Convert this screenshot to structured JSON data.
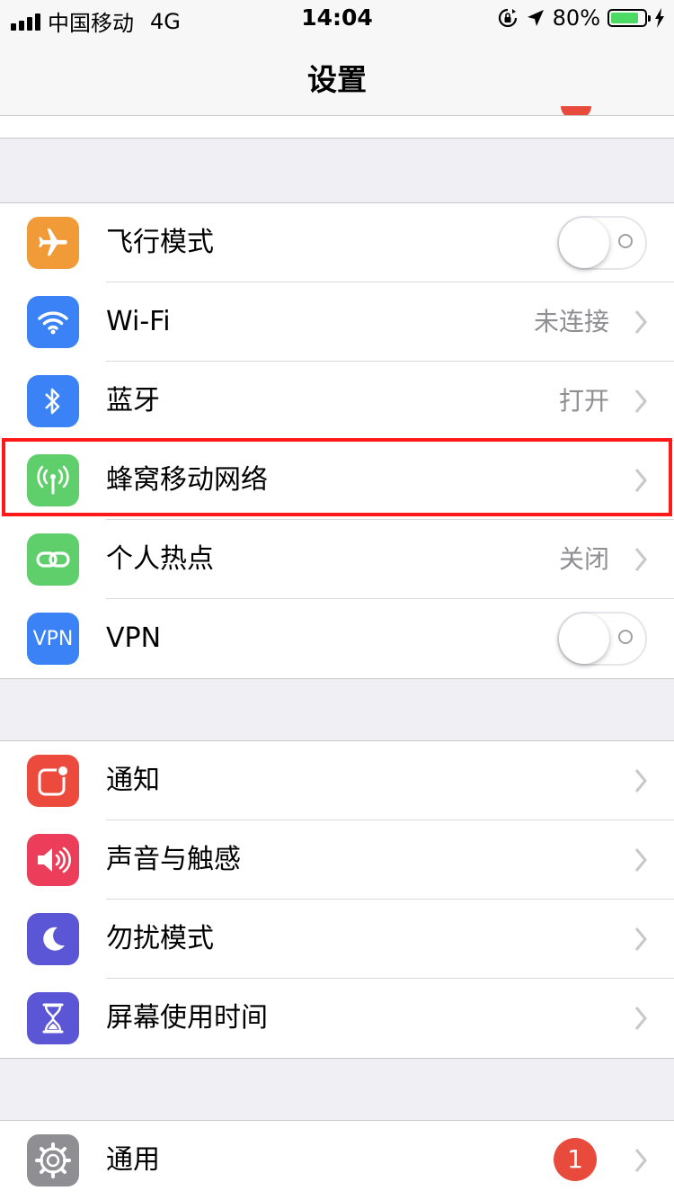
{
  "status_bar": {
    "carrier": "中国移动",
    "network": "4G",
    "time": "14:04",
    "battery": "80%"
  },
  "nav": {
    "title": "设置"
  },
  "colors": {
    "accent_red": "#e84a3c",
    "highlight": "#ff1a1a",
    "toggle_off": "#ffffff"
  },
  "group1": {
    "airplane": {
      "label": "飞行模式",
      "icon": "airplane-icon",
      "toggle_on": false
    },
    "wifi": {
      "label": "Wi-Fi",
      "value": "未连接",
      "icon": "wifi-icon"
    },
    "bluetooth": {
      "label": "蓝牙",
      "value": "打开",
      "icon": "bluetooth-icon"
    },
    "cellular": {
      "label": "蜂窝移动网络",
      "icon": "antenna-icon"
    },
    "hotspot": {
      "label": "个人热点",
      "value": "关闭",
      "icon": "hotspot-icon"
    },
    "vpn": {
      "label": "VPN",
      "icon_text": "VPN",
      "toggle_on": false
    }
  },
  "group2": {
    "notifications": {
      "label": "通知",
      "icon": "notifications-icon"
    },
    "sounds": {
      "label": "声音与触感",
      "icon": "speaker-icon"
    },
    "dnd": {
      "label": "勿扰模式",
      "icon": "moon-icon"
    },
    "screentime": {
      "label": "屏幕使用时间",
      "icon": "hourglass-icon"
    }
  },
  "group3": {
    "general": {
      "label": "通用",
      "badge": "1",
      "icon": "gear-icon"
    }
  }
}
